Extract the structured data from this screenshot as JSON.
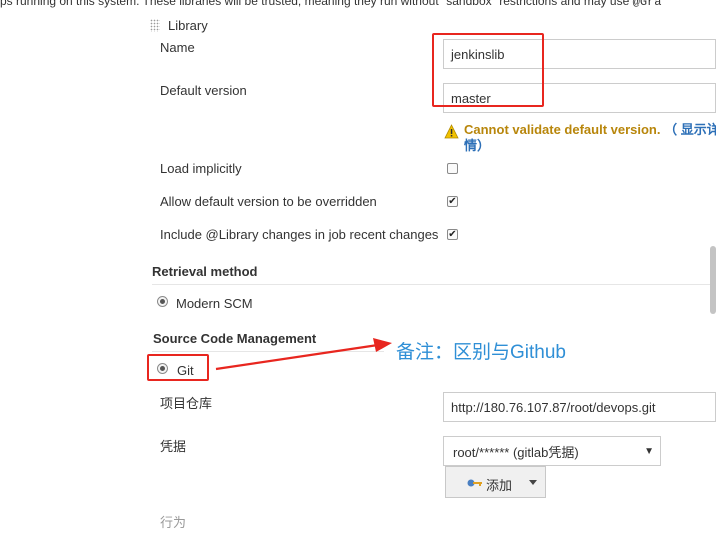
{
  "top_note": {
    "text": "ps running on this system. These libraries will be trusted, meaning they run without \"sandbox\" restrictions and may use",
    "code": "@Gra"
  },
  "library": {
    "header": "Library",
    "name_label": "Name",
    "name_value": "jenkinslib",
    "default_version_label": "Default version",
    "default_version_value": "master",
    "warning_text": "Cannot validate default version.",
    "warning_link": "（ 显示详",
    "warning_link_2": "情）",
    "load_implicitly_label": "Load implicitly",
    "load_implicitly_checked": false,
    "allow_override_label": "Allow default version to be overridden",
    "allow_override_checked": true,
    "include_changes_label": "Include @Library changes in job recent changes",
    "include_changes_checked": true
  },
  "retrieval": {
    "title": "Retrieval method",
    "option_label": "Modern SCM",
    "option_selected": true
  },
  "scm": {
    "title": "Source Code Management",
    "git_label": "Git",
    "git_selected": true,
    "repo_label": "项目仓库",
    "repo_value": "http://180.76.107.87/root/devops.git",
    "credentials_label": "凭据",
    "credentials_value": "root/****** (gitlab凭据)",
    "add_button_label": "添加",
    "behaviors_label": "行为"
  },
  "annotation": {
    "text": "备注：区别与Github",
    "color": "#2f8fd6",
    "highlight_color": "#e8261f"
  },
  "icons": {
    "warning": "warning-icon",
    "key": "key-icon",
    "select_arrow": "triangle-down-icon",
    "button_arrow": "caret-down-icon",
    "drag": "drag-handle-icon"
  }
}
